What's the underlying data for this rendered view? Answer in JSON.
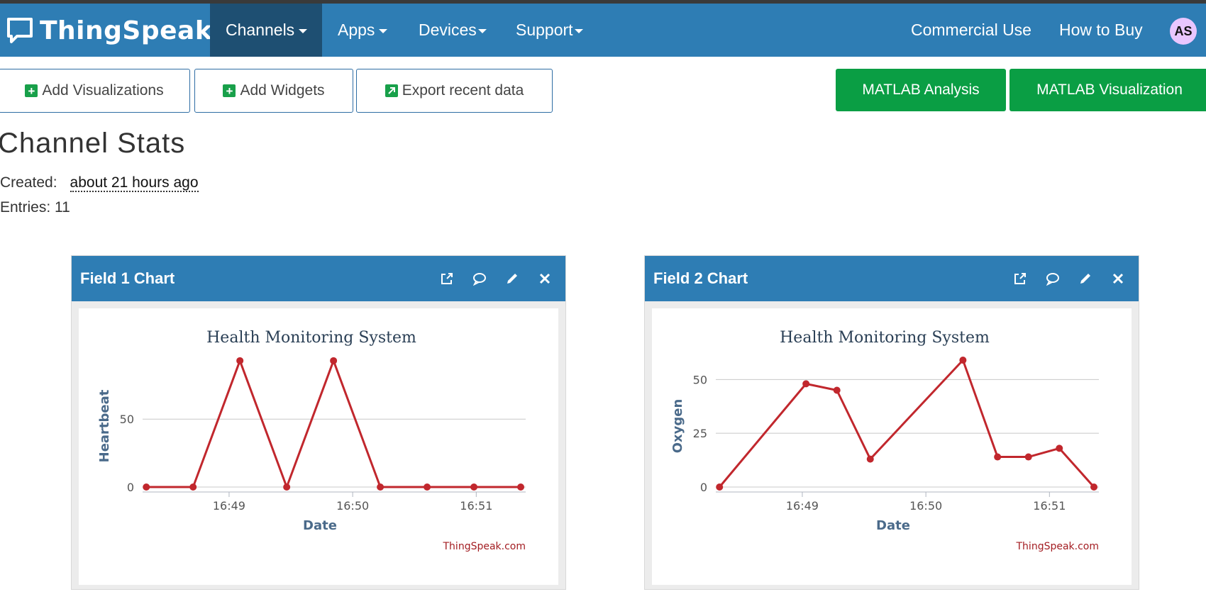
{
  "nav": {
    "brand": "ThingSpeak",
    "brand_tm": "™",
    "items": [
      "Channels",
      "Apps",
      "Devices",
      "Support"
    ],
    "right_items": [
      "Commercial Use",
      "How to Buy"
    ],
    "avatar": "AS"
  },
  "toolbar": {
    "add_visualizations": "Add Visualizations",
    "add_widgets": "Add Widgets",
    "export": "Export recent data",
    "matlab_analysis": "MATLAB Analysis",
    "matlab_visualization": "MATLAB Visualization"
  },
  "stats": {
    "title": "Channel Stats",
    "created_label": "Created:",
    "created_value": "about 21 hours ago",
    "entries_label": "Entries:",
    "entries_value": "11"
  },
  "panels": [
    {
      "title": "Field 1 Chart"
    },
    {
      "title": "Field 2 Chart"
    }
  ],
  "colors": {
    "nav": "#2e7db4",
    "nav_active": "#1e4f72",
    "green": "#0a9e44",
    "line": "#c1272d"
  },
  "chart_data": [
    {
      "type": "line",
      "title": "Health Monitoring System",
      "xlabel": "Date",
      "ylabel": "Heartbeat",
      "credit": "ThingSpeak.com",
      "x_ticks": [
        "16:49",
        "16:50",
        "16:51"
      ],
      "x_ticks_min": [
        0.7,
        1.7,
        2.7
      ],
      "x_range_min": [
        0.0,
        3.1
      ],
      "y_ticks": [
        0,
        50
      ],
      "ylim": [
        0,
        95
      ],
      "x_min": [
        0.03,
        0.73,
        1.25,
        1.76,
        2.28,
        2.53,
        2.78,
        3.06
      ],
      "values": [
        0,
        0,
        93,
        0,
        93,
        0,
        0,
        0,
        0
      ]
    },
    {
      "type": "line",
      "title": "Health Monitoring System",
      "xlabel": "Date",
      "ylabel": "Oxygen",
      "credit": "ThingSpeak.com",
      "x_ticks": [
        "16:49",
        "16:50",
        "16:51"
      ],
      "x_ticks_min": [
        0.7,
        1.7,
        2.7
      ],
      "x_range_min": [
        0.0,
        3.1
      ],
      "y_ticks": [
        0,
        25,
        50
      ],
      "ylim": [
        0,
        60
      ],
      "x_min": [
        0.03,
        0.73,
        0.98,
        1.25,
        2.0,
        2.28,
        2.53,
        2.78,
        3.06
      ],
      "values": [
        0,
        48,
        45,
        13,
        59,
        14,
        14,
        18,
        0
      ]
    }
  ]
}
